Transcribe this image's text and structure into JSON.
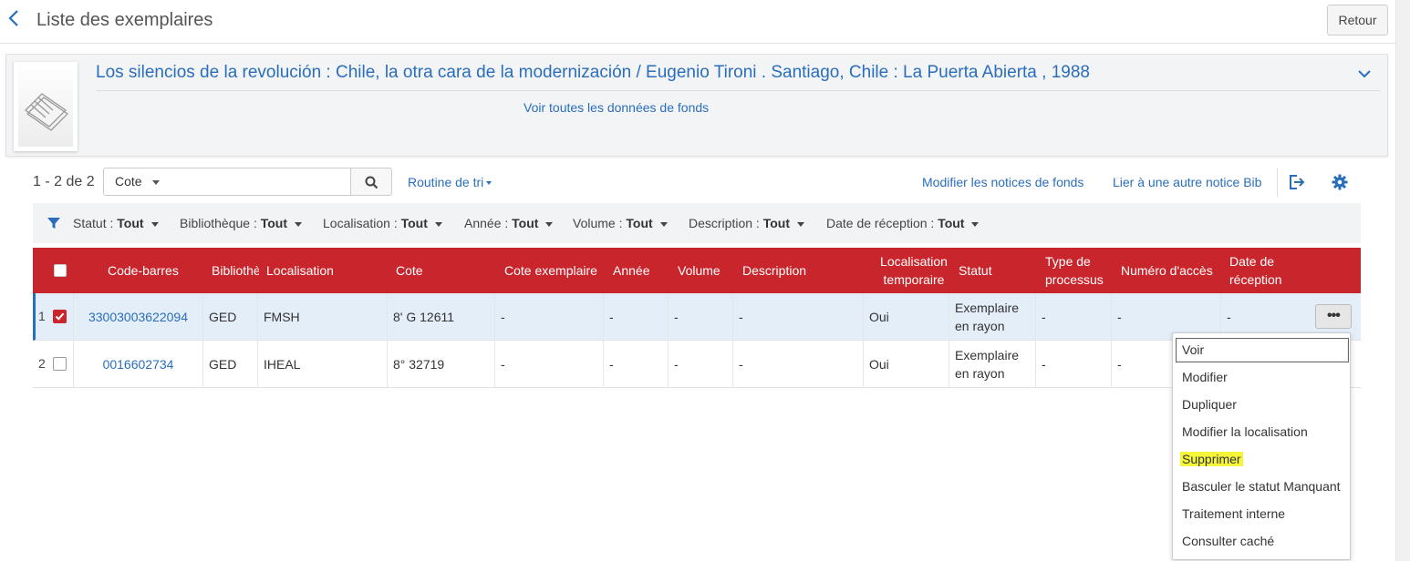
{
  "header": {
    "title": "Liste des exemplaires",
    "back_button": "Retour"
  },
  "record": {
    "title": "Los silencios de la revolución : Chile, la otra cara de la modernización / Eugenio Tironi . Santiago, Chile : La Puerta Abierta , 1988",
    "holdings_link": "Voir toutes les données de fonds"
  },
  "toolbar": {
    "count": "1 - 2 de 2",
    "search_field": "Cote",
    "search_value": "",
    "sort_label": "Routine de tri",
    "edit_holdings": "Modifier les notices de fonds",
    "link_bib": "Lier à une autre notice Bib"
  },
  "filters": [
    {
      "label": "Statut :",
      "value": "Tout"
    },
    {
      "label": "Bibliothèque :",
      "value": "Tout"
    },
    {
      "label": "Localisation :",
      "value": "Tout"
    },
    {
      "label": "Année :",
      "value": "Tout"
    },
    {
      "label": "Volume :",
      "value": "Tout"
    },
    {
      "label": "Description :",
      "value": "Tout"
    },
    {
      "label": "Date de réception :",
      "value": "Tout"
    }
  ],
  "table": {
    "columns": [
      "Code-barres",
      "Bibliothèque",
      "Localisation",
      "Cote",
      "Cote exemplaire",
      "Année",
      "Volume",
      "Description",
      "Localisation temporaire",
      "Statut",
      "Type de processus",
      "Numéro d'accès",
      "Date de réception"
    ],
    "rows": [
      {
        "num": "1",
        "checked": true,
        "barcode": "33003003622094",
        "library": "GED",
        "location": "FMSH",
        "call_number": "8' G 12611",
        "item_call": "-",
        "year": "-",
        "volume": "-",
        "description": "-",
        "temp_location": "Oui",
        "status": "Exemplaire en rayon",
        "process_type": "-",
        "accession": "-",
        "receipt_date": "-"
      },
      {
        "num": "2",
        "checked": false,
        "barcode": "0016602734",
        "library": "GED",
        "location": "IHEAL",
        "call_number": "8° 32719",
        "item_call": "-",
        "year": "-",
        "volume": "-",
        "description": "-",
        "temp_location": "Oui",
        "status": "Exemplaire en rayon",
        "process_type": "-",
        "accession": "-",
        "receipt_date": "-"
      }
    ]
  },
  "menu": {
    "actions_glyph": "•••",
    "items": [
      "Voir",
      "Modifier",
      "Dupliquer",
      "Modifier la localisation",
      "Supprimer",
      "Basculer le statut Manquant",
      "Traitement interne",
      "Consulter caché"
    ]
  },
  "colors": {
    "accent": "#2a6ebb",
    "table_header": "#c8262c",
    "highlight": "#f5f53a"
  }
}
